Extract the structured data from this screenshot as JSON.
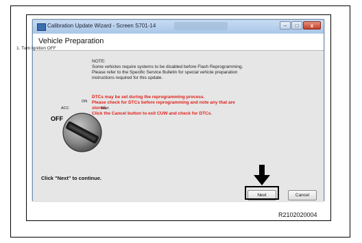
{
  "window": {
    "title": "Calibration Update Wizard - Screen S701-14",
    "header": "Vehicle Preparation",
    "controls": [
      "–",
      "□",
      "x"
    ]
  },
  "content": {
    "step": "1. Turn Ignition OFF",
    "note_lines": [
      "NOTE:",
      "Some vehicles require systems to be disabled before Flash Reprogramming.",
      "Please refer to the Specific Service Bulletin for special vehicle preparation",
      "instructions required for this update."
    ],
    "warning_lines": [
      "DTCs may be set during the reprogramming process.",
      "Please check for DTCs before reprogramming and note any that are",
      "stored.",
      "Click the Cancel button to exit CUW and check for DTCs."
    ],
    "dial": {
      "acc": "ACC",
      "on": "ON",
      "start": "Start",
      "off": "OFF"
    },
    "continue_text": "Click \"Next\" to continue."
  },
  "buttons": {
    "next": "Next",
    "cancel": "Cancel"
  },
  "figure_code": "R2102020004",
  "colors": {
    "warning": "#e0201a",
    "title_bar": "#a9c6e8",
    "highlight": "#000000"
  },
  "icons": [
    "app-icon",
    "arrow-down-icon",
    "ignition-key-icon"
  ]
}
